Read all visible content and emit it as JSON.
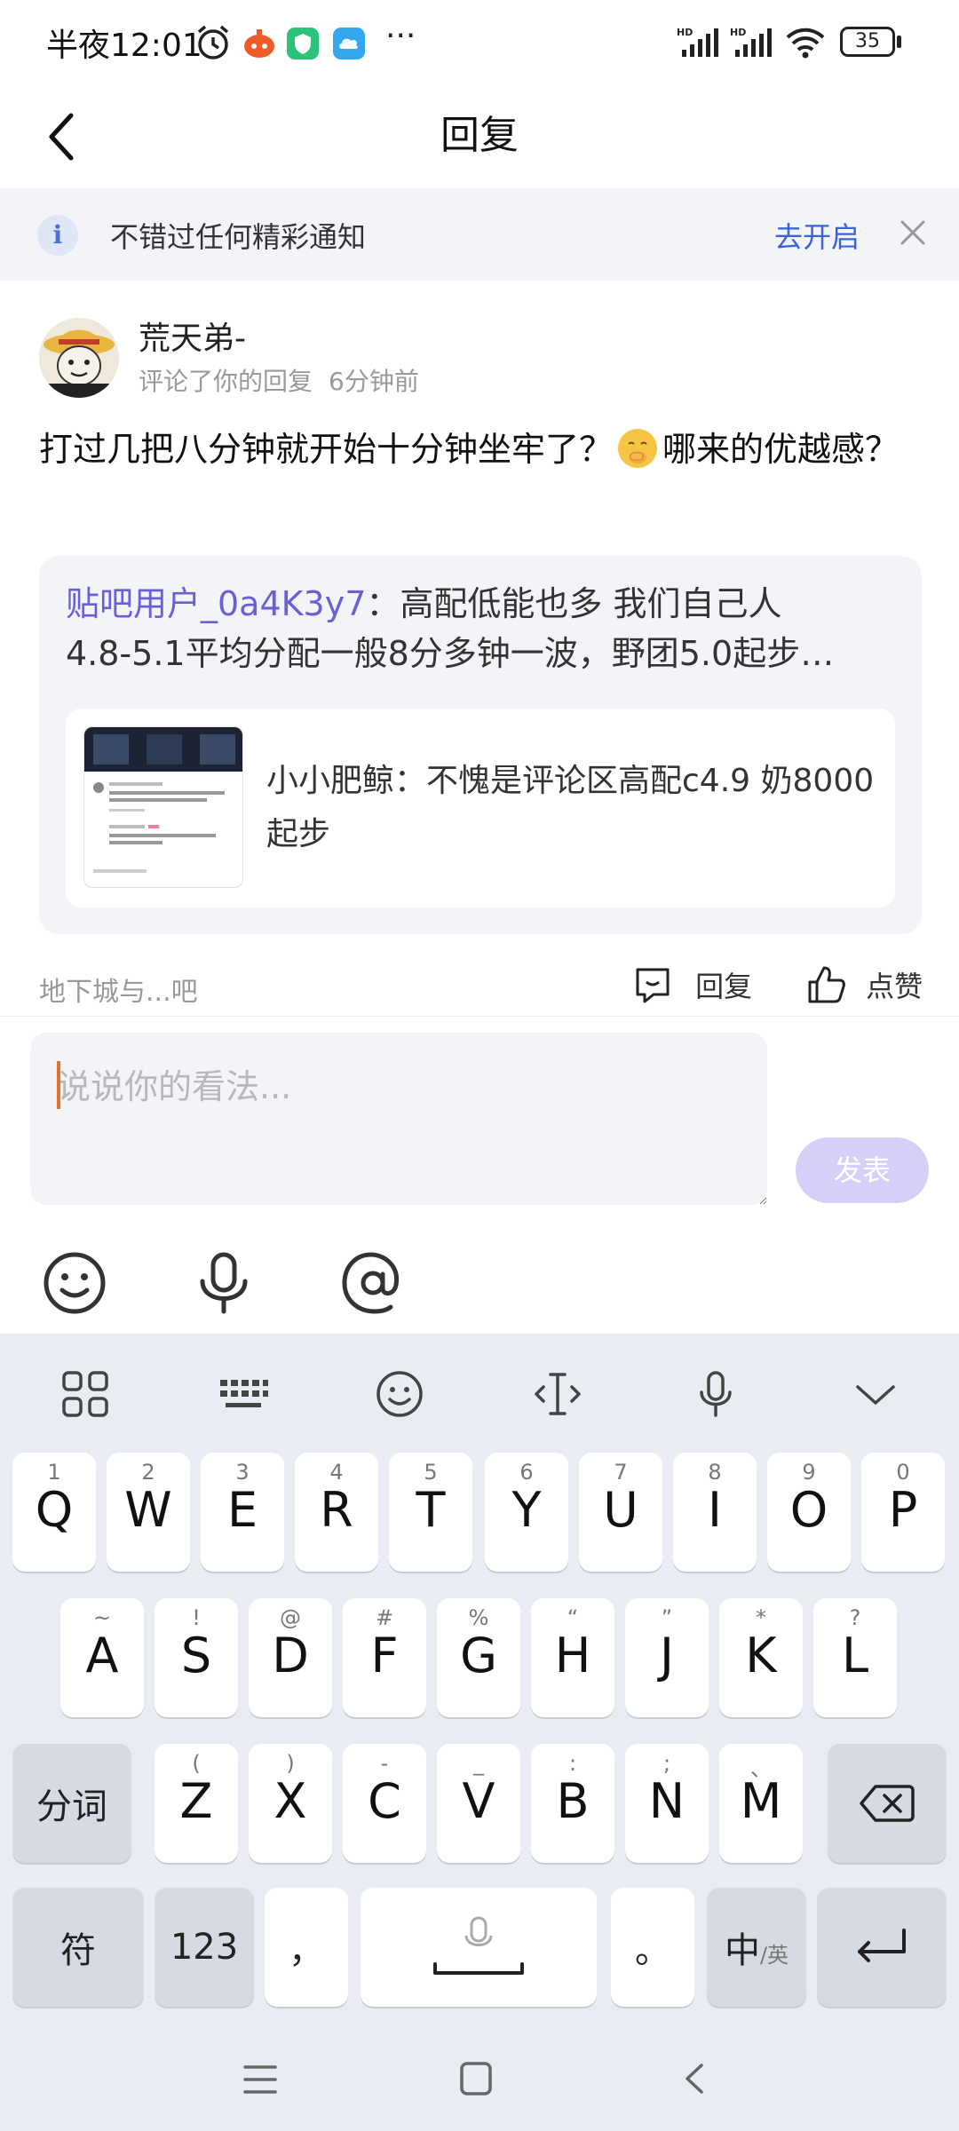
{
  "status_bar": {
    "time": "半夜12:01",
    "more": "···",
    "battery": "35"
  },
  "header": {
    "title": "回复"
  },
  "notice": {
    "text": "不错过任何精彩通知",
    "action": "去开启",
    "info_glyph": "i"
  },
  "comment": {
    "username": "荒天弟-",
    "action_text": "评论了你的回复",
    "time": "6分钟前",
    "text_part1": "打过几把八分钟就开始十分钟坐牢了？",
    "text_part2": "哪来的优越感？",
    "quote": {
      "user": "贴吧用户_0a4K3y7",
      "separator": "：",
      "line1": "高配低能也多 我们自己人",
      "line2": "4.8-5.1平均分配一般8分多钟一波，野团5.0起步…",
      "inner_user": "小小肥鲸",
      "inner_text": "：不愧是评论区高配c4.9 奶8000起步"
    },
    "forum": "地下城与...吧",
    "reply_label": "回复",
    "like_label": "点赞"
  },
  "composer": {
    "placeholder": "说说你的看法...",
    "send_label": "发表"
  },
  "keyboard": {
    "row1": [
      {
        "key": "Q",
        "sub": "1"
      },
      {
        "key": "W",
        "sub": "2"
      },
      {
        "key": "E",
        "sub": "3"
      },
      {
        "key": "R",
        "sub": "4"
      },
      {
        "key": "T",
        "sub": "5"
      },
      {
        "key": "Y",
        "sub": "6"
      },
      {
        "key": "U",
        "sub": "7"
      },
      {
        "key": "I",
        "sub": "8"
      },
      {
        "key": "O",
        "sub": "9"
      },
      {
        "key": "P",
        "sub": "0"
      }
    ],
    "row2": [
      {
        "key": "A",
        "sub": "~"
      },
      {
        "key": "S",
        "sub": "!"
      },
      {
        "key": "D",
        "sub": "@"
      },
      {
        "key": "F",
        "sub": "#"
      },
      {
        "key": "G",
        "sub": "%"
      },
      {
        "key": "H",
        "sub": "“"
      },
      {
        "key": "J",
        "sub": "”"
      },
      {
        "key": "K",
        "sub": "*"
      },
      {
        "key": "L",
        "sub": "?"
      }
    ],
    "row3": [
      {
        "key": "Z",
        "sub": "("
      },
      {
        "key": "X",
        "sub": ")"
      },
      {
        "key": "C",
        "sub": "-"
      },
      {
        "key": "V",
        "sub": "_"
      },
      {
        "key": "B",
        "sub": ":"
      },
      {
        "key": "N",
        "sub": ";"
      },
      {
        "key": "M",
        "sub": "、"
      }
    ],
    "fenci": "分词",
    "symbol": "符",
    "num": "123",
    "comma": "，",
    "period": "。",
    "lang_main": "中",
    "lang_sub": "/英"
  },
  "colors": {
    "accent_blue": "#3a63d8",
    "quote_user": "#6c5fd6",
    "send_disabled": "#d6cff8",
    "keyboard_bg": "#e9ecf2"
  }
}
